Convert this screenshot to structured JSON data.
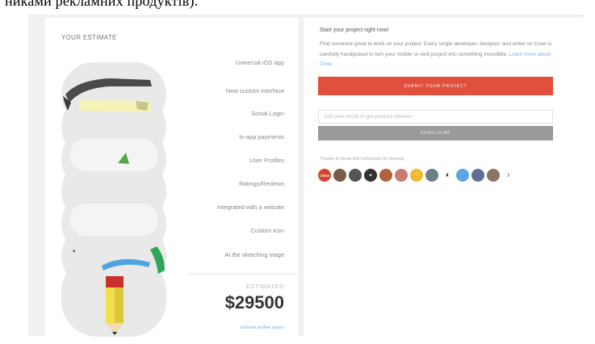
{
  "caption": "никами рекламних продуктів).",
  "estimate": {
    "title": "YOUR ESTIMATE",
    "features": [
      "Universal iOS app",
      "New custom interface",
      "Social Login",
      "In-app payments",
      "User Profiles",
      "Ratings/Reviews",
      "Integrated with a website",
      "Custom icon",
      "At the sketching stage"
    ],
    "estimated_label": "ESTIMATED",
    "price": "$29500",
    "link": "Estimate another project"
  },
  "project": {
    "title": "Start your project right now!",
    "body": "Find someone great to work on your project. Every single developer, designer, and writer on Crew is carefully handpicked to turn your mobile or web project into something incredible.",
    "learn_more": "Learn more about Crew.",
    "submit_label": "SUBMIT YOUR PROJECT",
    "email_placeholder": "Add your email to get product updates",
    "subscribe_label": "SUBSCRIBE",
    "thanks": "Thanks to these fine individuals for helping.",
    "avatars": [
      {
        "name": "crew-logo-avatar",
        "color": "#d2452f",
        "glyph": "CREW"
      },
      {
        "name": "person-avatar-1",
        "color": "#7a5a48",
        "glyph": ""
      },
      {
        "name": "person-avatar-2",
        "color": "#555555",
        "glyph": ""
      },
      {
        "name": "symbol-avatar",
        "color": "#333333",
        "glyph": "✦"
      },
      {
        "name": "person-avatar-3",
        "color": "#b0643c",
        "glyph": ""
      },
      {
        "name": "person-avatar-4",
        "color": "#c97c6f",
        "glyph": ""
      },
      {
        "name": "smiley-avatar",
        "color": "#f2b830",
        "glyph": "☺"
      },
      {
        "name": "object-avatar",
        "color": "#6b7f86",
        "glyph": ""
      },
      {
        "name": "bottle-avatar",
        "color": "#ffffff",
        "glyph": "♜"
      },
      {
        "name": "blue-dot-avatar",
        "color": "#5aa6e6",
        "glyph": ""
      },
      {
        "name": "person-avatar-5",
        "color": "#5f6f9a",
        "glyph": ""
      },
      {
        "name": "person-avatar-6",
        "color": "#8a7463",
        "glyph": ""
      },
      {
        "name": "figure-avatar",
        "color": "#ffffff",
        "glyph": "♗"
      }
    ]
  }
}
